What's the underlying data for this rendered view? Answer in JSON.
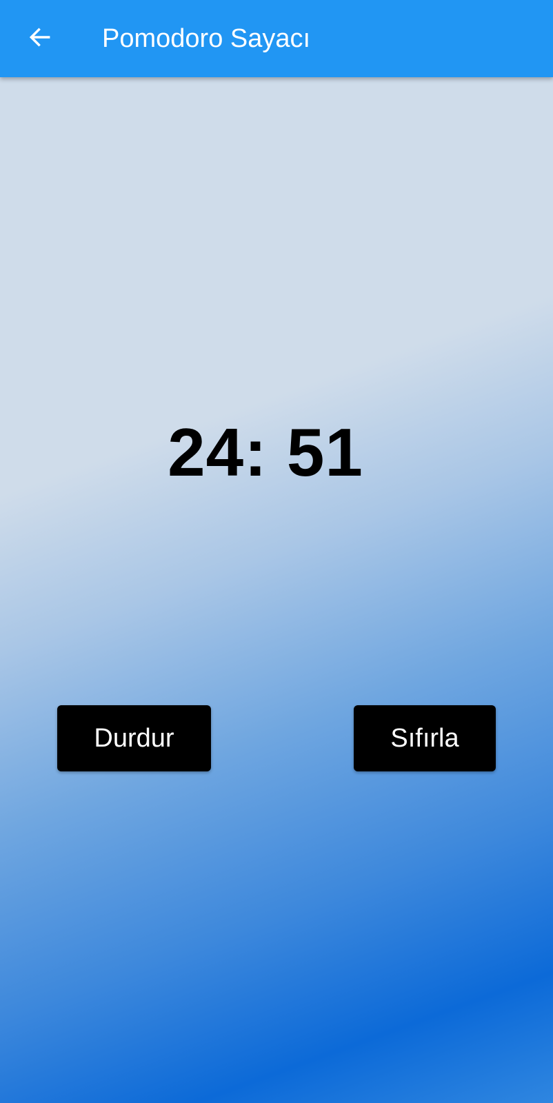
{
  "app_bar": {
    "title": "Pomodoro Sayacı",
    "back_icon": "arrow-left-icon",
    "background_color": "#2196f3"
  },
  "timer": {
    "display": "24: 51"
  },
  "buttons": {
    "stop_label": "Durdur",
    "reset_label": "Sıfırla"
  }
}
